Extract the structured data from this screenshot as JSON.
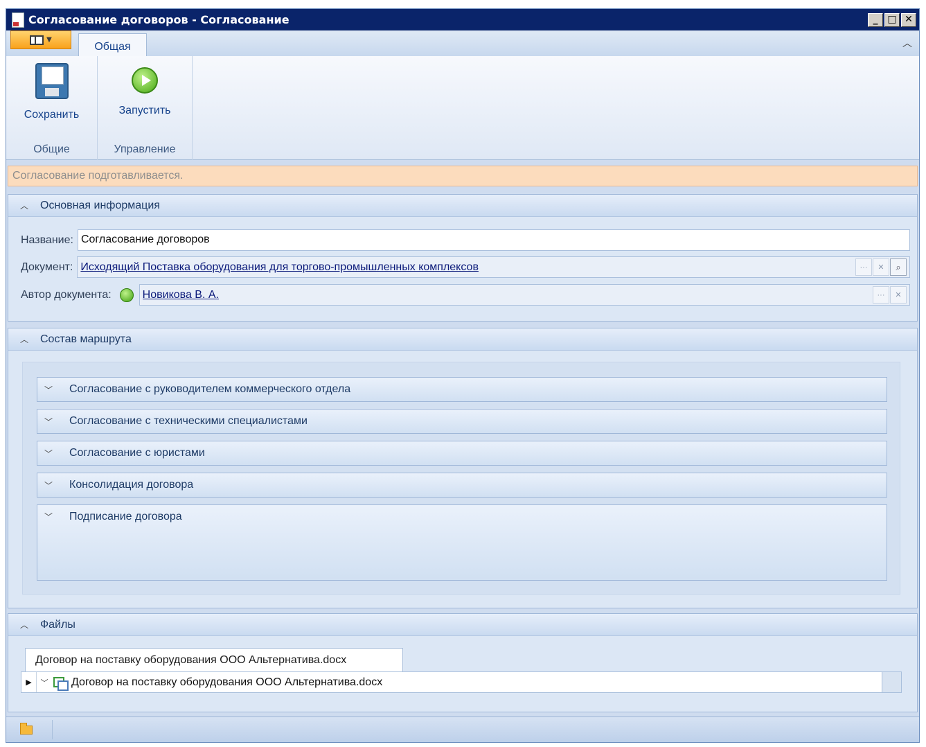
{
  "window": {
    "title": "Согласование договоров - Согласование",
    "buttons": [
      "_",
      "□",
      "✕"
    ]
  },
  "ribbon": {
    "tab_label": "Общая",
    "save_label": "Сохранить",
    "run_label": "Запустить",
    "group_general": "Общие",
    "group_control": "Управление"
  },
  "status_message": "Согласование подготавливается.",
  "main_info": {
    "header": "Основная информация",
    "name_label": "Название:",
    "name_value": "Согласование договоров",
    "document_label": "Документ:",
    "document_value": "Исходящий Поставка оборудования для торгово-промышленных комплексов",
    "author_label": "Автор документа:",
    "author_value": "Новикова В. А."
  },
  "route": {
    "header": "Состав маршрута",
    "stages": [
      {
        "label": "Согласование с руководителем коммерческого отдела"
      },
      {
        "label": "Согласование с техническими специалистами"
      },
      {
        "label": "Согласование с юристами"
      },
      {
        "label": "Консолидация договора"
      },
      {
        "label": "Подписание договора"
      }
    ]
  },
  "files": {
    "header": "Файлы",
    "tab_label": "Договор на поставку оборудования ООО Альтернатива.docx",
    "row_label": "Договор на поставку оборудования ООО Альтернатива.docx"
  },
  "colors": {
    "title_bar": "#0a246a",
    "status_banner": "#fcdcbd",
    "app_menu": "#f9a11b"
  }
}
